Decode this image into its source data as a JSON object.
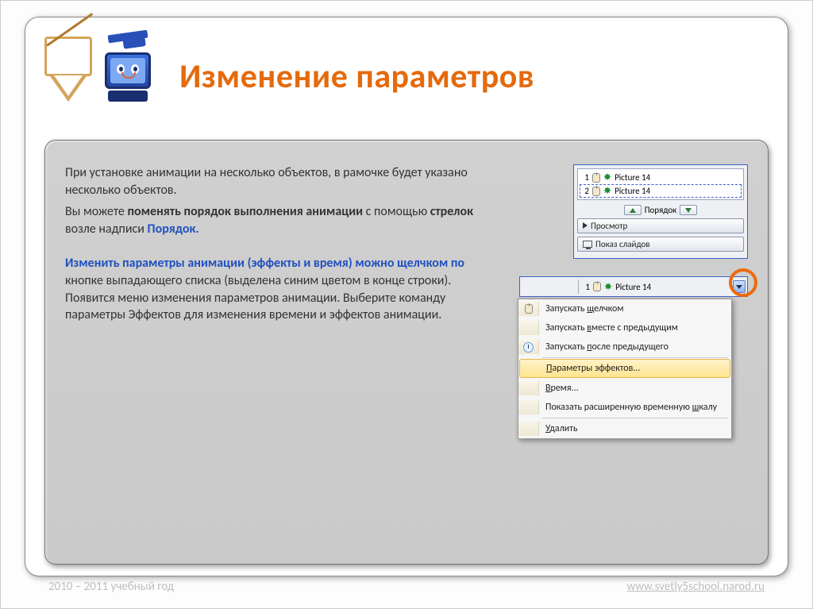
{
  "title": "Изменение параметров",
  "body": {
    "p1_a": "При установке анимации на несколько объектов, в рамочке будет указано несколько объектов.",
    "p2_a": "Вы можете ",
    "p2_b": "поменять порядок выполнения анимации",
    "p2_c": " с помощью ",
    "p2_d": "стрелок",
    "p2_e": " возле надписи ",
    "p2_f": "Порядок.",
    "p3_a": "Изменить параметры анимации (эффекты и время) можно щелчком по",
    "p3_b": " кнопке выпадающего списка (выделена синим цветом в конце строки). Появится меню изменения параметров анимации. Выберите команду параметры Эффектов для изменения времени и эффектов анимации."
  },
  "panel1": {
    "rows": [
      {
        "n": "1",
        "label": "Picture 14"
      },
      {
        "n": "2",
        "label": "Picture 14"
      }
    ],
    "order_label": "Порядок",
    "preview": "Просмотр",
    "slideshow": "Показ слайдов"
  },
  "panel2": {
    "toprow": {
      "n": "1",
      "label": "Picture 14"
    },
    "menu": {
      "m1_a": "Запускать ",
      "m1_u": "щ",
      "m1_b": "елчком",
      "m2_a": "Запускать ",
      "m2_u": "в",
      "m2_b": "месте с предыдущим",
      "m3_a": "Запускать ",
      "m3_u": "п",
      "m3_b": "осле предыдущего",
      "m4_u": "П",
      "m4_b": "араметры эффектов...",
      "m5_u": "В",
      "m5_b": "ремя...",
      "m6_a": "Показать расширенную временную ",
      "m6_u": "ш",
      "m6_b": "калу",
      "m7_u": "У",
      "m7_b": "далить"
    }
  },
  "footer": {
    "left": "2010 – 2011 учебный год",
    "right": "www.svetly5school.narod.ru"
  }
}
